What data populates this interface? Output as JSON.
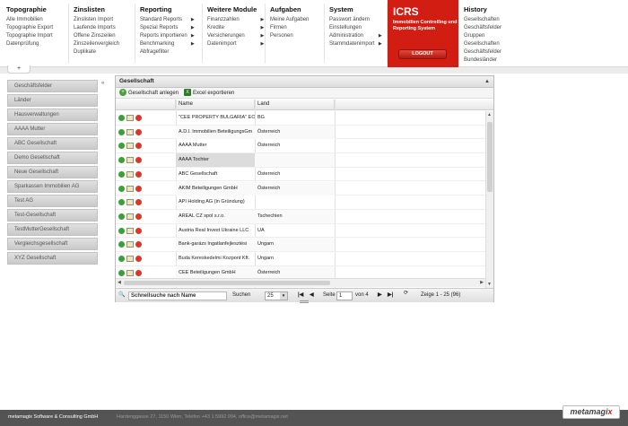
{
  "menu": {
    "columns": [
      {
        "head": "Topographie",
        "items": [
          "Alle Immobilien",
          "Topographie Export",
          "Topographie Import",
          "Datenprüfung"
        ],
        "arrows": [
          false,
          false,
          false,
          false
        ]
      },
      {
        "head": "Zinslisten",
        "items": [
          "Zinslisten Import",
          "Laufende Imports",
          "Offene Zinszeilen",
          "Zinszeilenvergleich",
          "Duplikate"
        ],
        "arrows": [
          false,
          false,
          false,
          false,
          false
        ]
      },
      {
        "head": "Reporting",
        "items": [
          "Standard Reports",
          "Spezial Reports",
          "Reports importieren",
          "Benchmarking",
          "Abfragefilter"
        ],
        "arrows": [
          true,
          true,
          true,
          true,
          false
        ]
      },
      {
        "head": "Weitere Module",
        "items": [
          "Finanzzahlen",
          "Kredite",
          "Versicherungen",
          "Datenimport"
        ],
        "arrows": [
          true,
          true,
          true,
          true
        ]
      },
      {
        "head": "Aufgaben",
        "items": [
          "Meine Aufgaben",
          "Firmen",
          "Personen"
        ],
        "arrows": [
          false,
          false,
          false
        ]
      },
      {
        "head": "System",
        "items": [
          "Passwort ändern",
          "Einstellungen",
          "Administration",
          "Stammdatenimport"
        ],
        "arrows": [
          false,
          false,
          true,
          true
        ]
      },
      {
        "head": "History",
        "items": [
          "Gesellschaften",
          "Geschäftsfelder",
          "Gruppen",
          "Gesellschaften",
          "Geschäftsfelder",
          "Bundesländer"
        ],
        "arrows": [
          false,
          false,
          false,
          false,
          false,
          false
        ]
      }
    ],
    "icrs": {
      "title": "ICRS",
      "subtitle": "Immobilien Controlling und Reporting System",
      "logout": "LOGOUT"
    }
  },
  "tabs": {
    "add": "+"
  },
  "sidebar": {
    "collapse": "«",
    "items": [
      "Geschäftsfelder",
      "Länder",
      "Hausverwaltungen",
      "AAAA Mutter",
      "ABC Gesellschaft",
      "Demo Gesellschaft",
      "Neue Gesellschaft",
      "Sparkassen Immobilien AG",
      "Test AG",
      "Test-Gesellschaft",
      "TestMutterGesellschaft",
      "Vergleichsgesellschaft",
      "XYZ Gesellschaft"
    ]
  },
  "panel": {
    "title": "Gesellschaft",
    "collapse": "▲",
    "toolbar": {
      "add": "Gesellschaft anlegen",
      "export": "Excel exportieren",
      "add_icon": "+",
      "export_icon": "X"
    },
    "columns": [
      "Name",
      "Land"
    ],
    "sort_indicator": "▲",
    "rows": [
      {
        "name": "\"CEE PROPERTY BULGARIA\" EO",
        "land": "BG"
      },
      {
        "name": "A.D.I. Immobilien BeteiligungsGm",
        "land": "Österreich"
      },
      {
        "name": "AAAA Mutter",
        "land": "Österreich"
      },
      {
        "name": "AAAA Tochter",
        "land": ""
      },
      {
        "name": "ABC Gesellschaft",
        "land": "Österreich"
      },
      {
        "name": "AKIM Beteiligungen GmbH",
        "land": "Österreich"
      },
      {
        "name": "API Holding AG (in Gründung)",
        "land": ""
      },
      {
        "name": "AREAL CZ spol s.r.o.",
        "land": "Tschechien"
      },
      {
        "name": "Austria Real Invest Ukraine LLC",
        "land": "UA"
      },
      {
        "name": "Bank-garázs Ingatlanfejlesztési",
        "land": "Ungarn"
      },
      {
        "name": "Buda Kereskedelmi Kozpont Kft.",
        "land": "Ungarn"
      },
      {
        "name": "CEE Beteiligungen GmbH",
        "land": "Österreich"
      }
    ],
    "pager": {
      "quicksearch_placeholder": "Schnellsuche nach Name",
      "search_label": "Suchen",
      "page_size": "25",
      "page_label": "Seite",
      "page_value": "1",
      "of_label": "von 4",
      "range_text": "Zeige 1 - 25 (96)",
      "first": "|◀",
      "prev": "◀",
      "next": "▶",
      "last": "▶|",
      "refresh": "⟳"
    }
  },
  "footer": {
    "company": "metamagix Software & Consulting GmbH",
    "address": "Hardenggasse 27, 1150 Wien, Telefon +43 1 5992 994, office@metamagix.net",
    "logo": "metamagix"
  },
  "colors": {
    "accent": "#d21d12",
    "footer": "#545454"
  }
}
